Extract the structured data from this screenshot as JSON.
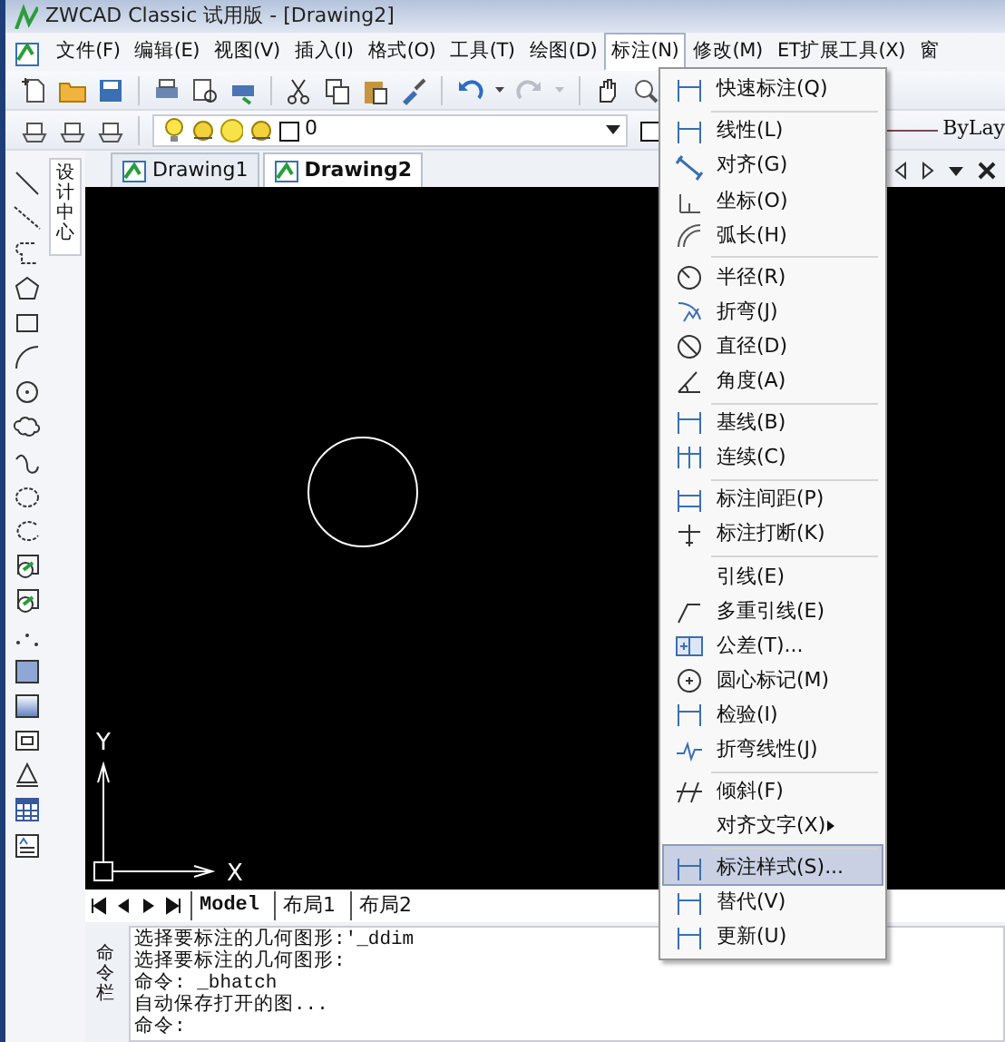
{
  "window": {
    "title": "ZWCAD Classic 试用版 - [Drawing2]"
  },
  "menu_bar": [
    {
      "label": "文件(F)",
      "selected": false
    },
    {
      "label": "编辑(E)",
      "selected": false
    },
    {
      "label": "视图(V)",
      "selected": false
    },
    {
      "label": "插入(I)",
      "selected": false
    },
    {
      "label": "格式(O)",
      "selected": false
    },
    {
      "label": "工具(T)",
      "selected": false
    },
    {
      "label": "绘图(D)",
      "selected": false
    },
    {
      "label": "标注(N)",
      "selected": true
    },
    {
      "label": "修改(M)",
      "selected": false
    },
    {
      "label": "ET扩展工具(X)",
      "selected": false
    },
    {
      "label": "窗",
      "selected": false
    }
  ],
  "layer_toolbar": {
    "layer": "0",
    "linetype": "ByLay"
  },
  "design_center_tab": {
    "label": "设计中心"
  },
  "document_tabs": [
    {
      "label": "Drawing1",
      "selected": false
    },
    {
      "label": "Drawing2",
      "selected": true
    }
  ],
  "drawing": {
    "y_label": "Y",
    "x_label": "X"
  },
  "layout_tabs": [
    {
      "label": "Model",
      "selected": true
    },
    {
      "label": "布局1",
      "selected": false
    },
    {
      "label": "布局2",
      "selected": false
    }
  ],
  "command_panel": {
    "label": "命令栏",
    "lines": [
      "选择要标注的几何图形:'_ddim",
      "选择要标注的几何图形:",
      "命令: _bhatch",
      "自动保存打开的图...",
      "命令:"
    ]
  },
  "dropdown_menu": {
    "items": [
      {
        "label": "快速标注(Q)",
        "separator_before": false,
        "submenu": false,
        "selected": false
      },
      {
        "label": "线性(L)",
        "separator_before": true,
        "submenu": false,
        "selected": false
      },
      {
        "label": "对齐(G)",
        "separator_before": false,
        "submenu": false,
        "selected": false
      },
      {
        "label": "坐标(O)",
        "separator_before": false,
        "submenu": false,
        "selected": false
      },
      {
        "label": "弧长(H)",
        "separator_before": false,
        "submenu": false,
        "selected": false
      },
      {
        "label": "半径(R)",
        "separator_before": true,
        "submenu": false,
        "selected": false
      },
      {
        "label": "折弯(J)",
        "separator_before": false,
        "submenu": false,
        "selected": false
      },
      {
        "label": "直径(D)",
        "separator_before": false,
        "submenu": false,
        "selected": false
      },
      {
        "label": "角度(A)",
        "separator_before": false,
        "submenu": false,
        "selected": false
      },
      {
        "label": "基线(B)",
        "separator_before": true,
        "submenu": false,
        "selected": false
      },
      {
        "label": "连续(C)",
        "separator_before": false,
        "submenu": false,
        "selected": false
      },
      {
        "label": "标注间距(P)",
        "separator_before": true,
        "submenu": false,
        "selected": false
      },
      {
        "label": "标注打断(K)",
        "separator_before": false,
        "submenu": false,
        "selected": false
      },
      {
        "label": "引线(E)",
        "separator_before": true,
        "submenu": false,
        "selected": false
      },
      {
        "label": "多重引线(E)",
        "separator_before": false,
        "submenu": false,
        "selected": false
      },
      {
        "label": "公差(T)...",
        "separator_before": false,
        "submenu": false,
        "selected": false
      },
      {
        "label": "圆心标记(M)",
        "separator_before": false,
        "submenu": false,
        "selected": false
      },
      {
        "label": "检验(I)",
        "separator_before": false,
        "submenu": false,
        "selected": false
      },
      {
        "label": "折弯线性(J)",
        "separator_before": false,
        "submenu": false,
        "selected": false
      },
      {
        "label": "倾斜(F)",
        "separator_before": true,
        "submenu": false,
        "selected": false
      },
      {
        "label": "对齐文字(X)",
        "separator_before": false,
        "submenu": true,
        "selected": false
      },
      {
        "label": "标注样式(S)...",
        "separator_before": true,
        "submenu": false,
        "selected": true
      },
      {
        "label": "替代(V)",
        "separator_before": false,
        "submenu": false,
        "selected": false
      },
      {
        "label": "更新(U)",
        "separator_before": false,
        "submenu": false,
        "selected": false
      }
    ]
  }
}
